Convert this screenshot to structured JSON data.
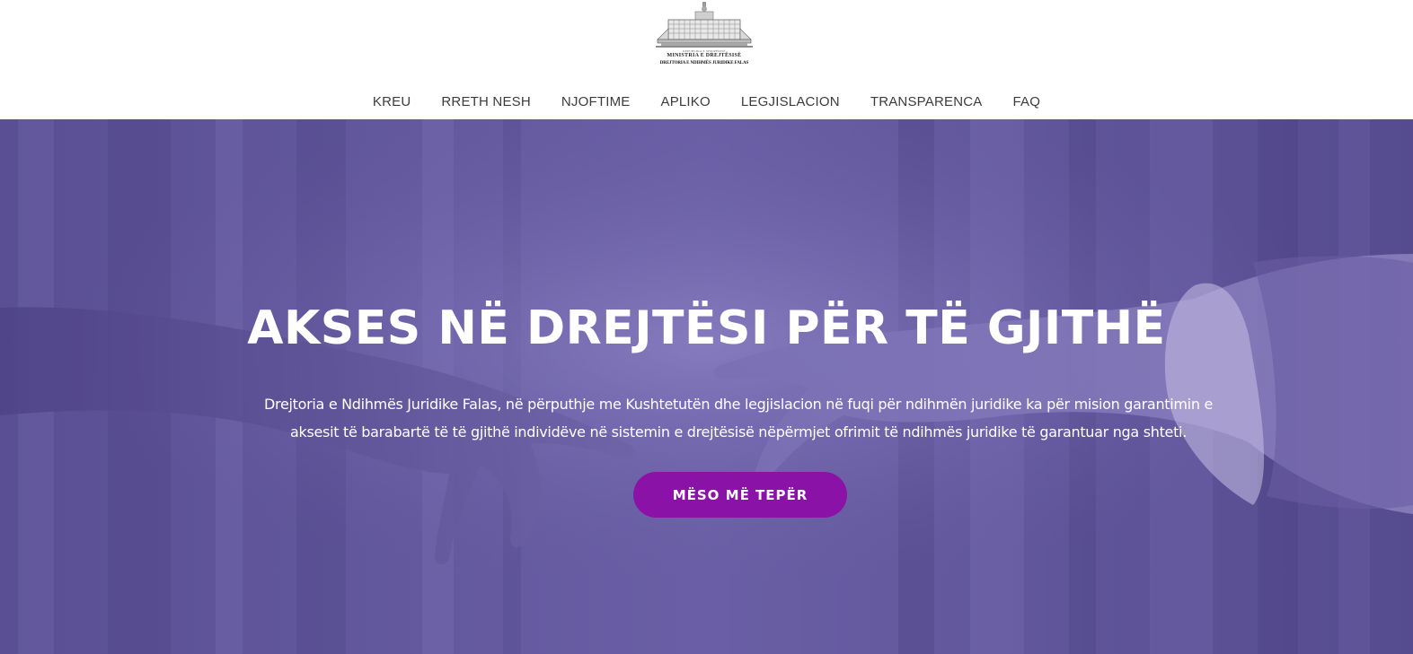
{
  "header": {
    "logo": {
      "line_top": "REPUBLIKA E SHQIPËRISË",
      "line_mid": "MINISTRIA  E  DREJTËSISË",
      "line_bot": "DREJTORIA E NDIHMËS JURIDIKE FALAS"
    },
    "nav": [
      {
        "label": "KREU"
      },
      {
        "label": "RRETH NESH"
      },
      {
        "label": "NJOFTIME"
      },
      {
        "label": "APLIKO"
      },
      {
        "label": "LEGJISLACION"
      },
      {
        "label": "TRANSPARENCA"
      },
      {
        "label": "FAQ"
      }
    ]
  },
  "hero": {
    "title": "AKSES NË DREJTËSI PËR TË GJITHË",
    "description": "Drejtoria e Ndihmës Juridike Falas, në përputhje me Kushtetutën dhe legjislacion në fuqi për ndihmën juridike ka për mision garantimin e aksesit të barabartë të të gjithë individëve në sistemin e drejtësisë nëpërmjet ofrimit të ndihmës juridike të garantuar nga shteti.",
    "cta_label": "MËSO MË TEPËR"
  },
  "colors": {
    "overlay": "#5f539a",
    "cta": "#8a12a6",
    "nav_text": "#3c3c3c"
  }
}
